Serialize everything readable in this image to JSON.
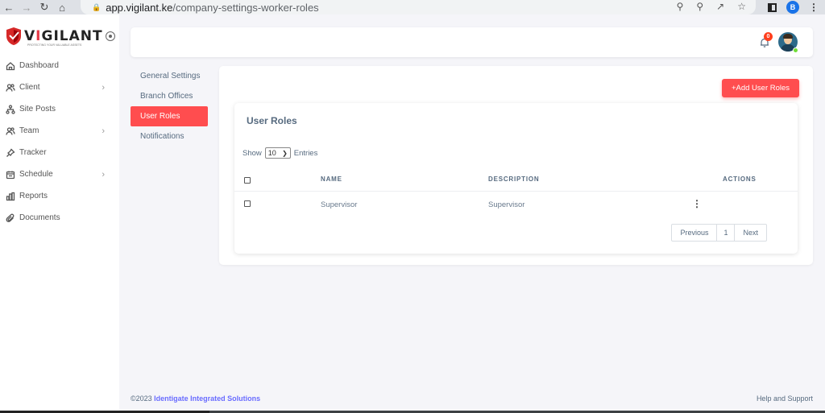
{
  "browser": {
    "url_host": "app.vigilant.ke",
    "url_path": "/company-settings-worker-roles",
    "profile_initial": "B"
  },
  "brand": {
    "logo_prefix": "V",
    "logo_i": "I",
    "logo_rest": "GILANT",
    "tagline": "PROTECTING YOUR VALUABLE ASSETS",
    "accent_color": "#ff4d4f"
  },
  "sidebar": {
    "items": [
      {
        "label": "Dashboard",
        "icon": "home-icon"
      },
      {
        "label": "Client",
        "icon": "users-icon"
      },
      {
        "label": "Site Posts",
        "icon": "sitemap-icon"
      },
      {
        "label": "Team",
        "icon": "team-icon"
      },
      {
        "label": "Tracker",
        "icon": "pin-icon"
      },
      {
        "label": "Schedule",
        "icon": "calendar-icon"
      },
      {
        "label": "Reports",
        "icon": "chart-icon"
      },
      {
        "label": "Documents",
        "icon": "paperclip-icon"
      }
    ]
  },
  "header": {
    "notification_count": "0"
  },
  "settings_nav": {
    "items": [
      "General Settings",
      "Branch Offices",
      "User Roles",
      "Notifications"
    ],
    "active": "User Roles"
  },
  "main": {
    "add_button": "+Add User Roles",
    "card_title": "User Roles",
    "show_label": "Show",
    "entries_value": "10",
    "entries_label": "Entries",
    "columns": [
      "NAME",
      "DESCRIPTION",
      "ACTIONS"
    ],
    "rows": [
      {
        "name": "Supervisor",
        "description": "Supervisor"
      }
    ],
    "pagination": {
      "previous": "Previous",
      "page": "1",
      "next": "Next"
    }
  },
  "footer": {
    "copyright": "©2023 ",
    "company": "Identigate Integrated Solutions",
    "help": "Help and Support"
  }
}
